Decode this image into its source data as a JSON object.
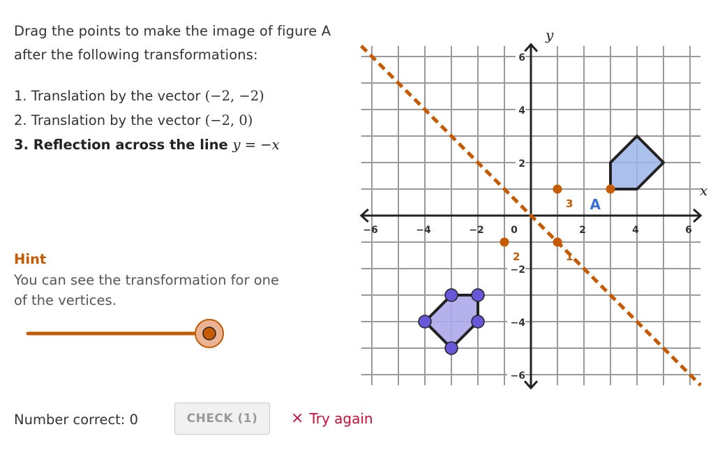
{
  "instructions": {
    "line1": "Drag the points to make the image of figure A",
    "line2": "after the following transformations:"
  },
  "steps": [
    {
      "prefix": "1. Translation by the vector ",
      "math": "(−2, −2)",
      "bold": false
    },
    {
      "prefix": "2. Translation by the vector ",
      "math": "(−2, 0)",
      "bold": false
    },
    {
      "prefix": "3. Reflection across the line ",
      "math": "y = −x",
      "bold": true
    }
  ],
  "hint": {
    "title": "Hint",
    "text": "You can see the transformation for one of the vertices.",
    "slider_value": 1.0,
    "color": "#c55a00"
  },
  "footer": {
    "score_label": "Number correct: 0",
    "check_label": "CHECK (1)",
    "feedback_icon": "×",
    "feedback_text": "Try again",
    "feedback_color": "#c3103a"
  },
  "graph": {
    "x_axis_label": "x",
    "y_axis_label": "y",
    "x_range": [
      -6.4,
      6.4
    ],
    "y_range": [
      -6.4,
      6.4
    ],
    "x_ticks": [
      {
        "value": -6,
        "label": "−6"
      },
      {
        "value": -4,
        "label": "−4"
      },
      {
        "value": -2,
        "label": "−2"
      },
      {
        "value": 0,
        "label": "0"
      },
      {
        "value": 2,
        "label": "2"
      },
      {
        "value": 4,
        "label": "4"
      },
      {
        "value": 6,
        "label": "6"
      }
    ],
    "y_ticks": [
      {
        "value": 6,
        "label": "6"
      },
      {
        "value": 4,
        "label": "4"
      },
      {
        "value": 2,
        "label": "2"
      },
      {
        "value": -2,
        "label": "−2"
      },
      {
        "value": -4,
        "label": "−4"
      },
      {
        "value": -6,
        "label": "−6"
      }
    ],
    "grid_step": 1,
    "reflection_line": {
      "equation": "y = -x",
      "color": "#c55a00",
      "style": "dashed"
    },
    "figure_A": {
      "label": "A",
      "label_color": "#3a6fd8",
      "vertices": [
        [
          3,
          1
        ],
        [
          3,
          2
        ],
        [
          4,
          3
        ],
        [
          5,
          2
        ],
        [
          4,
          1
        ]
      ],
      "fill": "#9db5ea",
      "label_pos": [
        2.4,
        0.4
      ]
    },
    "image_figure": {
      "vertices": [
        [
          -3,
          -3
        ],
        [
          -2,
          -3
        ],
        [
          -2,
          -4
        ],
        [
          -3,
          -5
        ],
        [
          -4,
          -4
        ]
      ],
      "fill": "#ada8ea",
      "point_color": "#6658d8"
    },
    "hint_points": [
      {
        "label": "",
        "pos": [
          3,
          1
        ]
      },
      {
        "label": "1",
        "pos": [
          1,
          -1
        ]
      },
      {
        "label": "2",
        "pos": [
          -1,
          -1
        ]
      },
      {
        "label": "3",
        "pos": [
          1,
          1
        ]
      }
    ],
    "hint_point_color": "#c55a00"
  }
}
